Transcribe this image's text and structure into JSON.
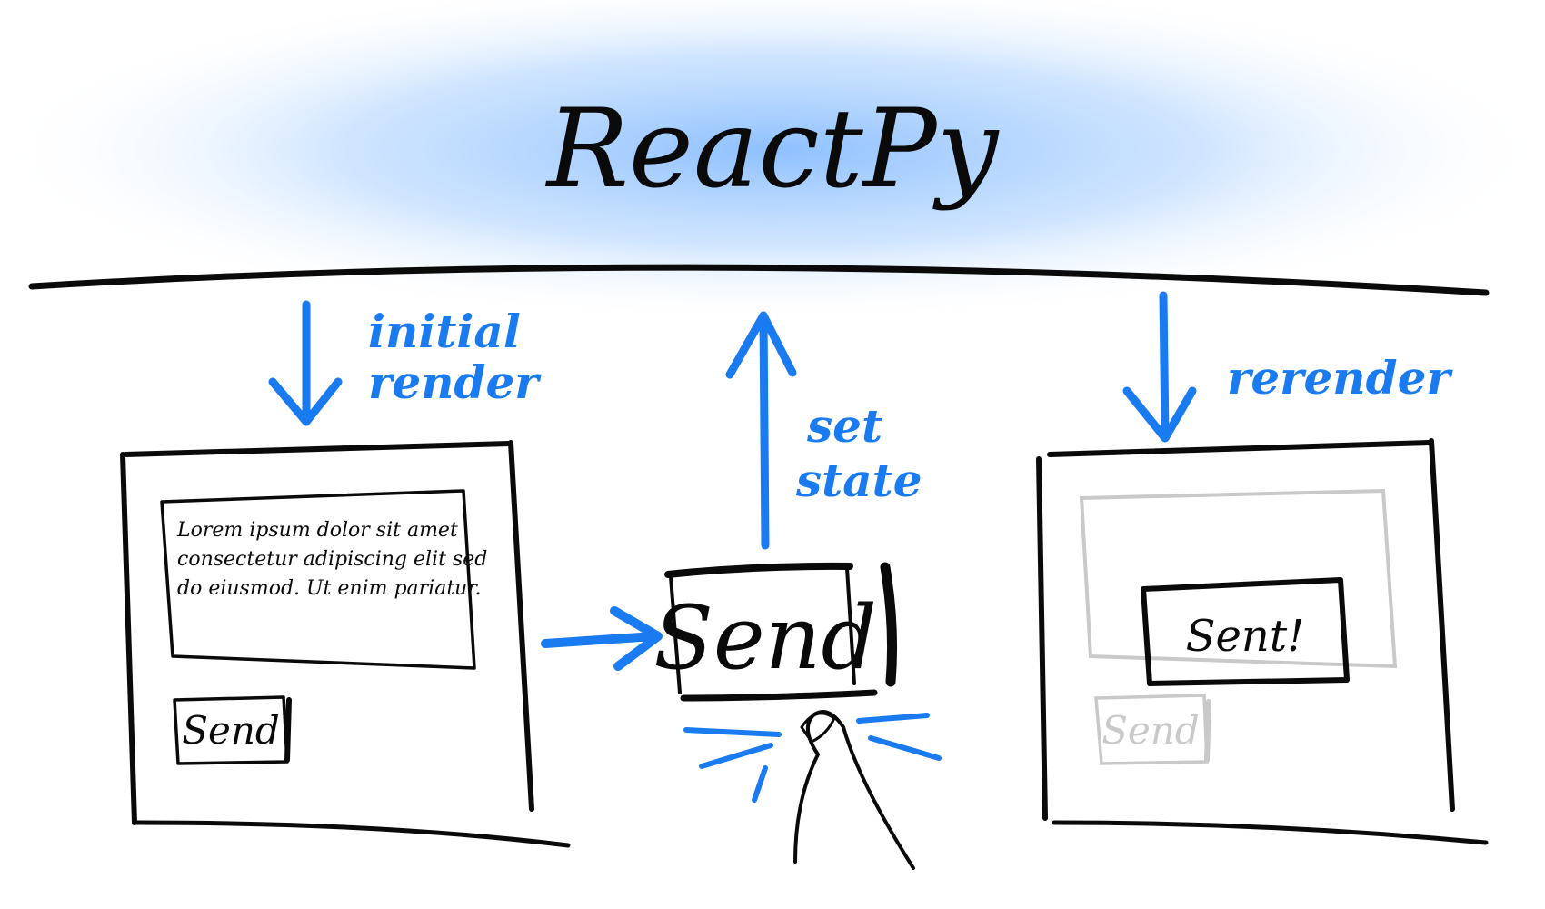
{
  "title": "ReactPy",
  "colors": {
    "accent": "#1a7bf0",
    "ink": "#0a0a0a",
    "glow": "#9ccaff",
    "faded": "#c9c9c9"
  },
  "labels": {
    "initial_render_line1": "initial",
    "initial_render_line2": "render",
    "set_state_line1": "set",
    "set_state_line2": "state",
    "rerender": "rerender"
  },
  "left_panel": {
    "text_lines": [
      "Lorem ipsum dolor sit amet",
      "consectetur adipiscing elit sed",
      "do eiusmod. Ut enim pariatur."
    ],
    "button": "Send"
  },
  "center": {
    "button": "Send"
  },
  "right_panel": {
    "popup": "Sent!",
    "button": "Send"
  }
}
